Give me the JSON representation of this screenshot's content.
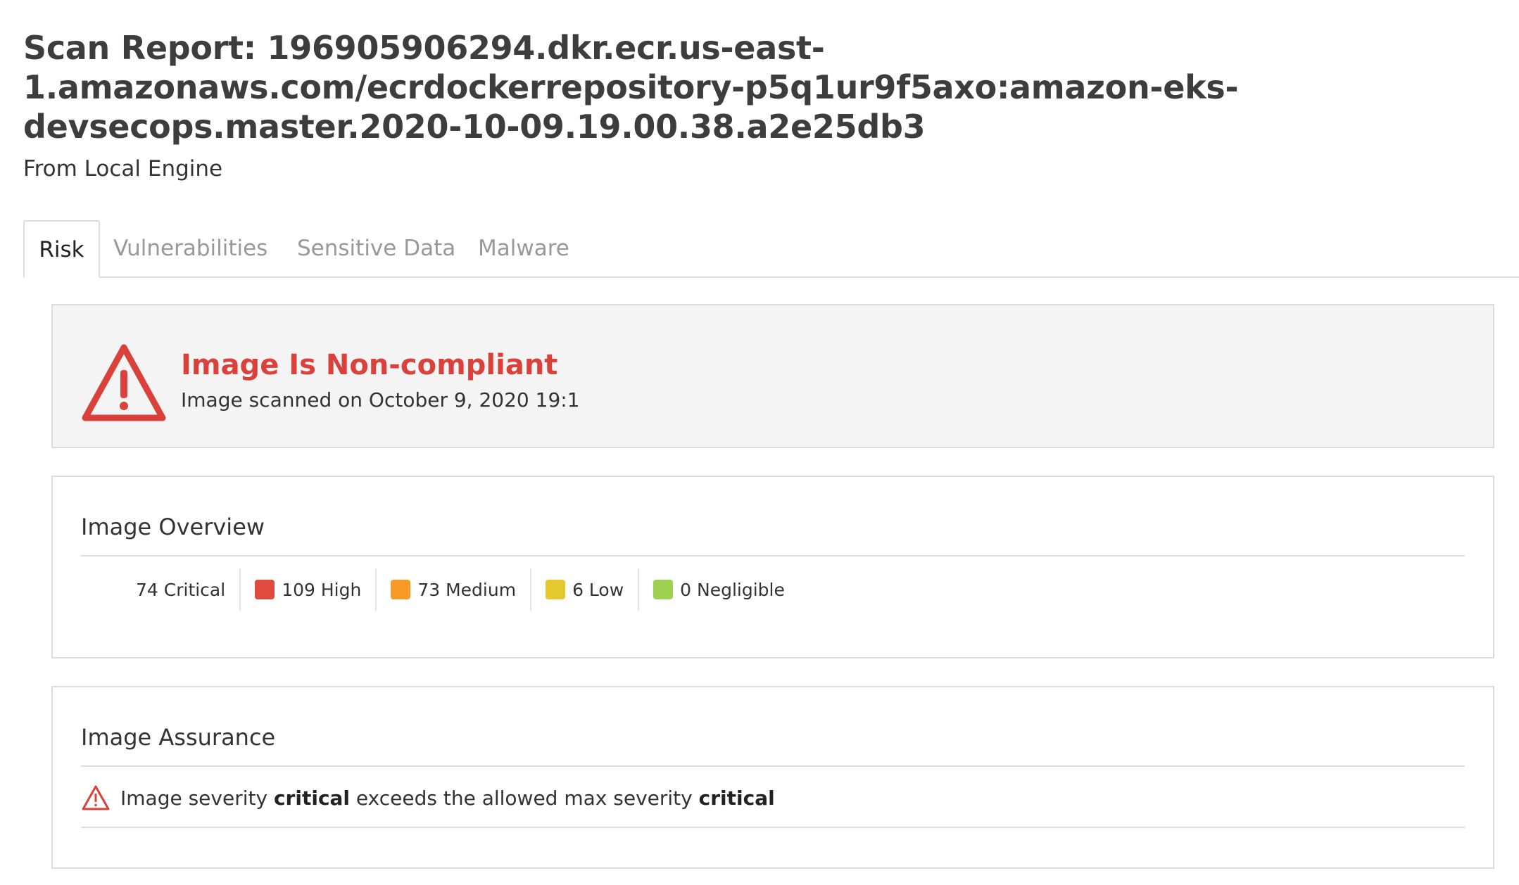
{
  "header": {
    "title_lines": [
      "Scan Report: 196905906294.dkr.ecr.us-east-",
      "1.amazonaws.com/ecrdockerrepository-p5q1ur9f5axo:amazon-eks-",
      "devsecops.master.2020-10-09.19.00.38.a2e25db3"
    ],
    "subtitle": "From Local Engine"
  },
  "tabs": [
    {
      "label": "Risk",
      "active": true
    },
    {
      "label": "Vulnerabilities",
      "active": false
    },
    {
      "label": "Sensitive Data",
      "active": false
    },
    {
      "label": "Malware",
      "active": false
    }
  ],
  "status": {
    "icon": "warning-triangle-icon",
    "title": "Image Is Non-compliant",
    "subtitle": "Image scanned on October 9, 2020 19:1",
    "color": "#d9413a"
  },
  "overview": {
    "heading": "Image Overview",
    "counts": [
      {
        "label": "74 Critical",
        "color": null
      },
      {
        "label": "109 High",
        "color": "#e04a3f"
      },
      {
        "label": "73 Medium",
        "color": "#f79a26"
      },
      {
        "label": "6 Low",
        "color": "#e5c82e"
      },
      {
        "label": "0 Negligible",
        "color": "#9fd150"
      }
    ]
  },
  "assurance": {
    "heading": "Image Assurance",
    "icon": "warning-triangle-icon",
    "message": {
      "prefix": "Image severity ",
      "severity": "critical",
      "middle": " exceeds the allowed max severity ",
      "max_severity": "critical"
    }
  }
}
